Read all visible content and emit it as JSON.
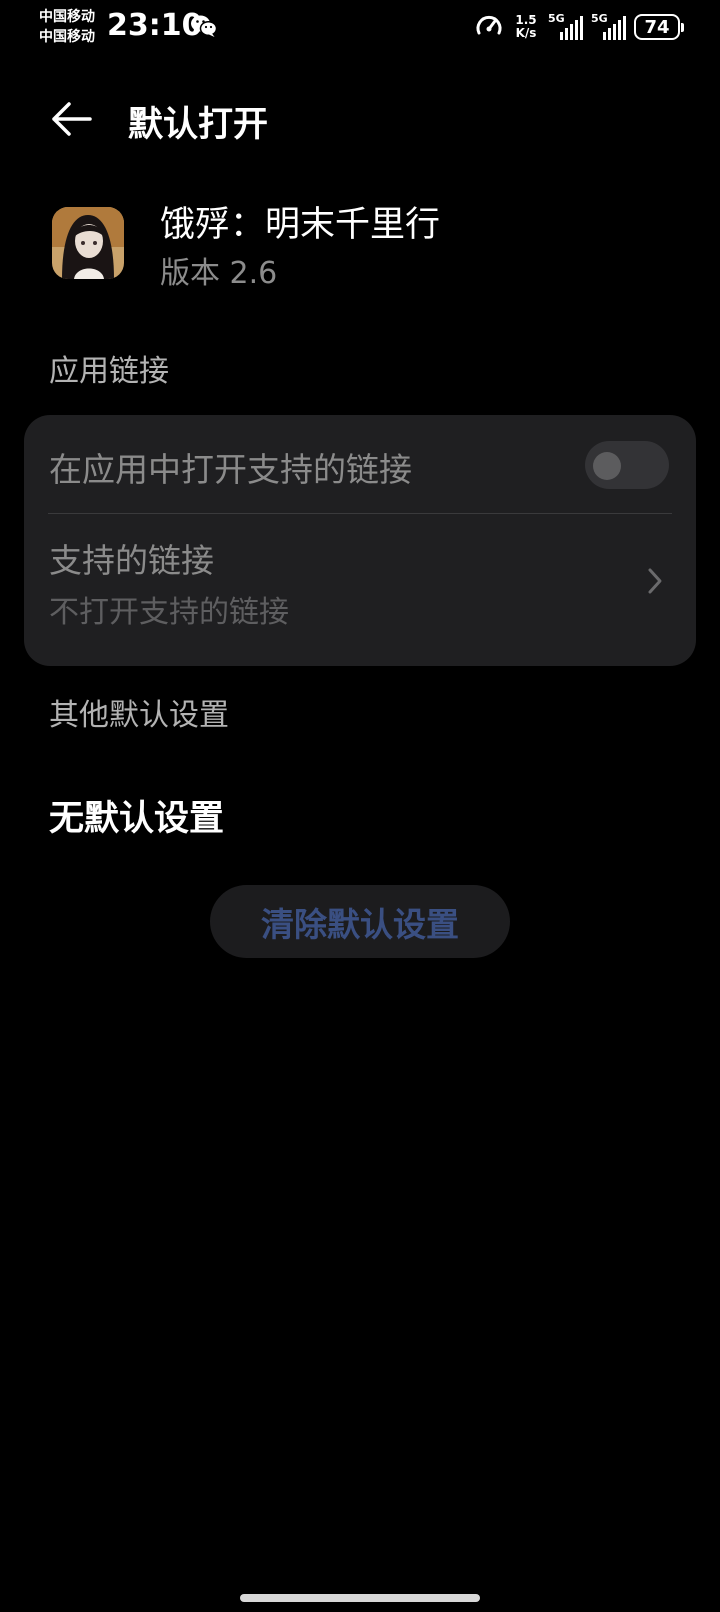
{
  "status_bar": {
    "carrier_1": "中国移动",
    "carrier_2": "中国移动",
    "time": "23:10",
    "net_speed_value": "1.5",
    "net_speed_unit": "K/s",
    "sim1_type": "5G",
    "sim2_type": "5G",
    "battery": "74",
    "icons": [
      "wechat-icon",
      "speed-meter-icon",
      "signal-icon",
      "battery-icon"
    ]
  },
  "header": {
    "title": "默认打开",
    "back_icon": "back-arrow-icon"
  },
  "app": {
    "name": "饿殍：明末千里行",
    "version": "版本 2.6"
  },
  "app_links": {
    "section_label": "应用链接",
    "open_supported_links_label": "在应用中打开支持的链接",
    "open_supported_links_enabled": false,
    "supported_links_title": "支持的链接",
    "supported_links_value": "不打开支持的链接"
  },
  "other_defaults": {
    "section_label": "其他默认设置",
    "status": "无默认设置",
    "clear_button": "清除默认设置"
  },
  "colors": {
    "background": "#000000",
    "card": "#1f1f21",
    "disabled_text": "#8b8b8b",
    "button_text_disabled": "#3a4f82"
  }
}
